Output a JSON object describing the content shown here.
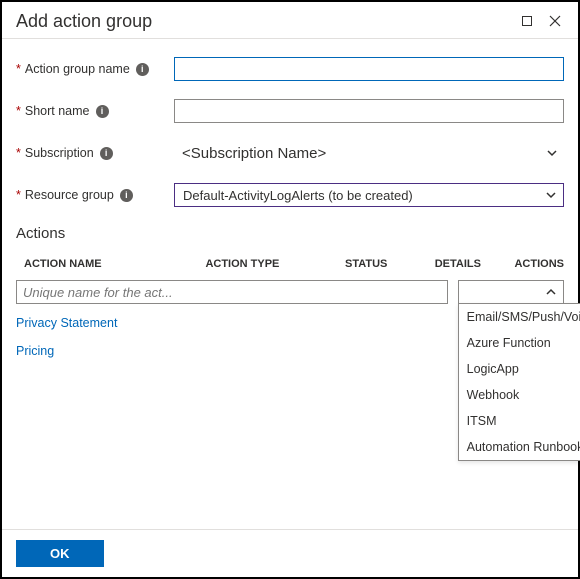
{
  "title": "Add action group",
  "fields": {
    "action_group_name": {
      "label": "Action group name",
      "value": ""
    },
    "short_name": {
      "label": "Short name",
      "value": ""
    },
    "subscription": {
      "label": "Subscription",
      "value": "<Subscription Name>"
    },
    "resource_group": {
      "label": "Resource group",
      "value": "Default-ActivityLogAlerts (to be created)"
    }
  },
  "actions_header": "Actions",
  "columns": {
    "name": "ACTION NAME",
    "type": "ACTION TYPE",
    "status": "STATUS",
    "details": "DETAILS",
    "actions": "ACTIONS"
  },
  "action_row": {
    "name_placeholder": "Unique name for the act...",
    "type_value": ""
  },
  "action_type_options": [
    "Email/SMS/Push/Voice",
    "Azure Function",
    "LogicApp",
    "Webhook",
    "ITSM",
    "Automation Runbook"
  ],
  "links": {
    "privacy": "Privacy Statement",
    "pricing": "Pricing"
  },
  "ok_label": "OK"
}
